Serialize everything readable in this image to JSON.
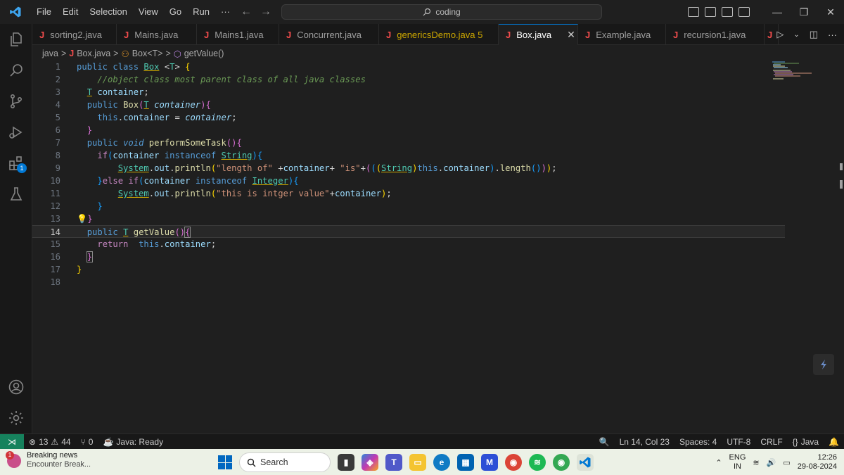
{
  "menu": [
    "File",
    "Edit",
    "Selection",
    "View",
    "Go",
    "Run",
    "···"
  ],
  "command_center": "coding",
  "tabs": [
    {
      "label": "sorting2.java",
      "state": "normal"
    },
    {
      "label": "Mains.java",
      "state": "normal"
    },
    {
      "label": "Mains1.java",
      "state": "normal"
    },
    {
      "label": "Concurrent.java",
      "state": "normal"
    },
    {
      "label": "genericsDemo.java",
      "badge": "5",
      "state": "modified"
    },
    {
      "label": "Box.java",
      "state": "active"
    },
    {
      "label": "Example.java",
      "state": "normal"
    },
    {
      "label": "recursion1.java",
      "state": "normal"
    }
  ],
  "breadcrumb": {
    "folder": "java",
    "file": "Box.java",
    "class": "Box<T>",
    "method": "getValue()"
  },
  "editor": {
    "current_line": 14,
    "lines": [
      "public class Box <T> {",
      "    //object class most parent class of all java classes",
      "  T container;",
      "  public Box(T container){",
      "    this.container = container;",
      "  }",
      "  public void performSomeTask(){",
      "    if(container instanceof String){",
      "        System.out.println(\"length of\" +container+ \"is\"+(((String)this.container).length()));",
      "    }else if(container instanceof Integer){",
      "        System.out.println(\"this is intger value\"+container);",
      "    }",
      "  }",
      "  public T getValue(){",
      "    return  this.container;",
      "  }",
      "}",
      ""
    ]
  },
  "statusbar": {
    "errors": "13",
    "warnings": "44",
    "ports": "0",
    "java_status": "Java: Ready",
    "position": "Ln 14, Col 23",
    "spaces": "Spaces: 4",
    "encoding": "UTF-8",
    "eol": "CRLF",
    "language": "Java"
  },
  "activity_badge": "1",
  "taskbar": {
    "news_title": "Breaking news",
    "news_subtitle": "Encounter Break...",
    "news_badge": "1",
    "search_label": "Search",
    "lang_line1": "ENG",
    "lang_line2": "IN",
    "time": "12:26",
    "date": "29-08-2024"
  },
  "colors": {
    "accent": "#0078d4",
    "remote": "#16825d",
    "java_icon": "#f14c4c"
  }
}
